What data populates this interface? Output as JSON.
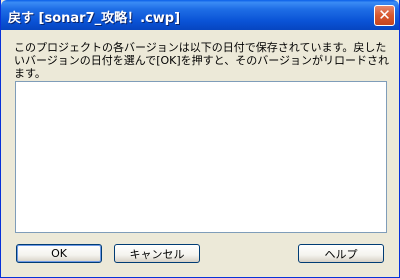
{
  "window": {
    "title": "戻す [sonar7_攻略！.cwp]",
    "close_glyph": "✕"
  },
  "content": {
    "description": "このプロジェクトの各バージョンは以下の日付で保存されています。戻したいバージョンの日付を選んで[OK]を押すと、そのバージョンがリロードされます。"
  },
  "buttons": {
    "ok": "OK",
    "cancel": "キャンセル",
    "help": "ヘルプ"
  }
}
